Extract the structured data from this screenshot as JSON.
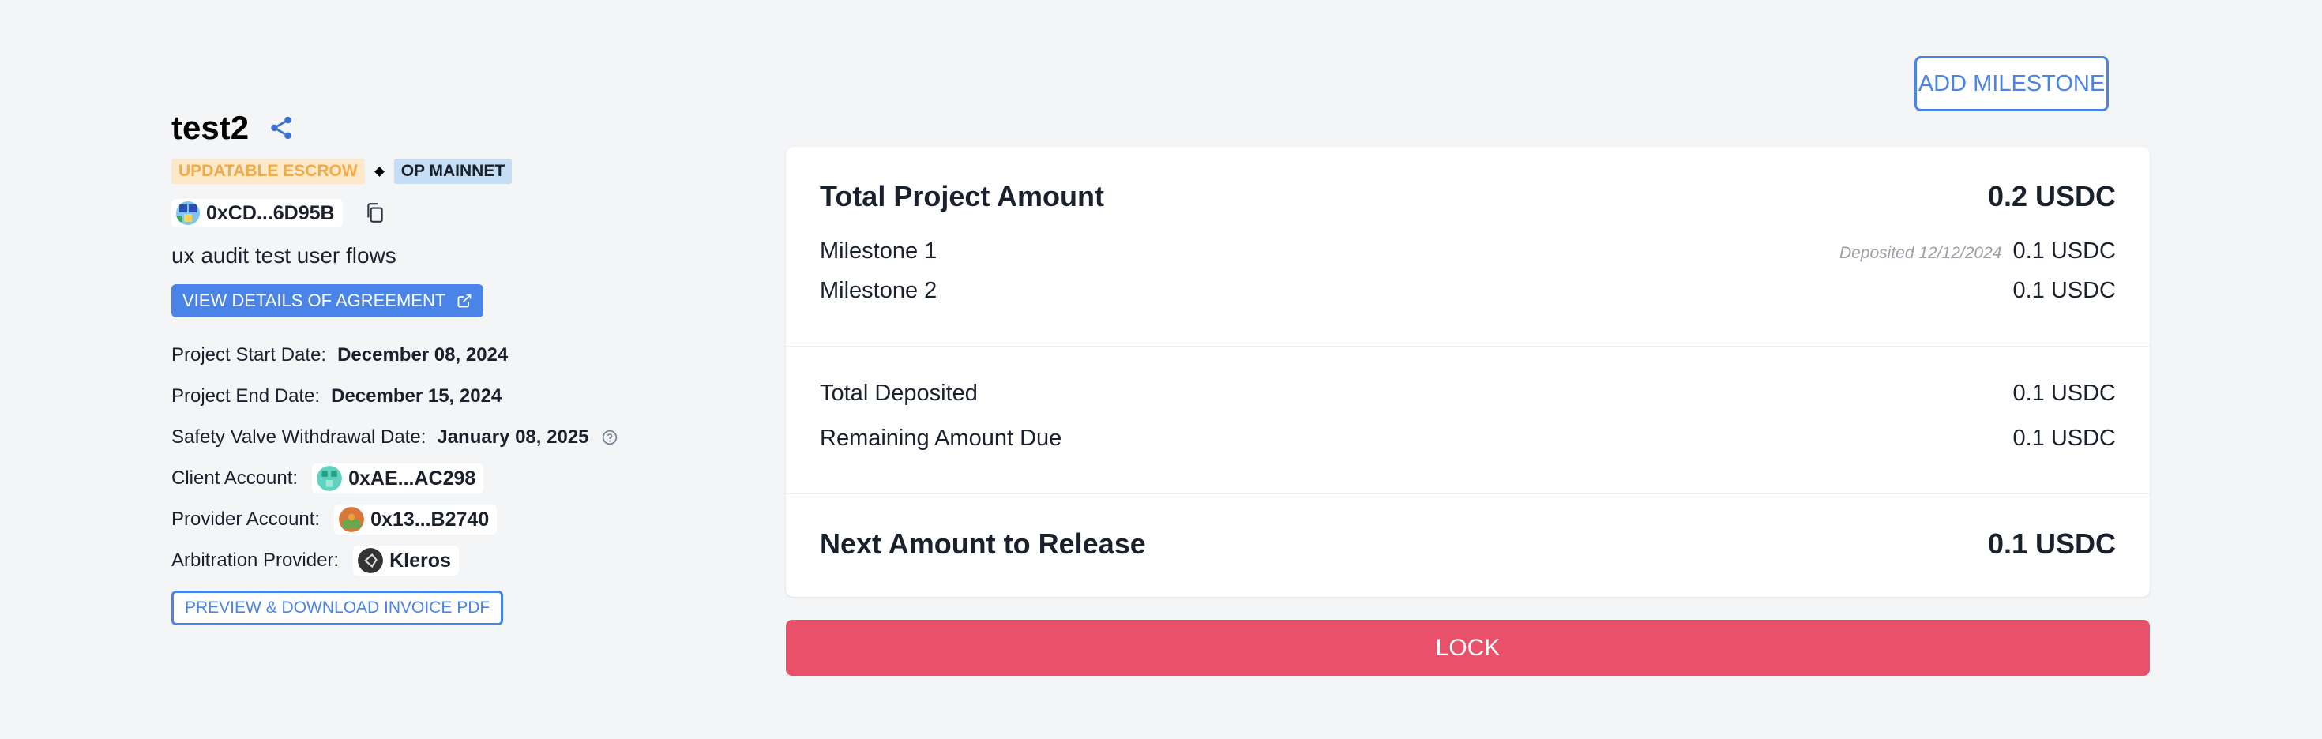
{
  "project": {
    "title": "test2",
    "escrow_badge": "UPDATABLE ESCROW",
    "network_badge": "OP MAINNET",
    "address": "0xCD...6D95B",
    "description": "ux audit test user flows",
    "view_details_label": "VIEW DETAILS OF AGREEMENT",
    "start_label": "Project Start Date:",
    "start_value": "December 08, 2024",
    "end_label": "Project End Date:",
    "end_value": "December 15, 2024",
    "safety_label": "Safety Valve Withdrawal Date:",
    "safety_value": "January 08, 2025",
    "client_label": "Client Account:",
    "client_value": "0xAE...AC298",
    "provider_label": "Provider Account:",
    "provider_value": "0x13...B2740",
    "arbitration_label": "Arbitration Provider:",
    "arbitration_value": "Kleros",
    "invoice_label": "PREVIEW & DOWNLOAD INVOICE PDF"
  },
  "actions": {
    "add_milestone": "ADD MILESTONE",
    "lock": "LOCK"
  },
  "summary": {
    "total_label": "Total Project Amount",
    "total_value": "0.2 USDC",
    "milestones": [
      {
        "label": "Milestone 1",
        "note": "Deposited 12/12/2024",
        "value": "0.1 USDC"
      },
      {
        "label": "Milestone 2",
        "note": "",
        "value": "0.1 USDC"
      }
    ],
    "deposited_label": "Total Deposited",
    "deposited_value": "0.1 USDC",
    "remaining_label": "Remaining Amount Due",
    "remaining_value": "0.1 USDC",
    "next_label": "Next Amount to Release",
    "next_value": "0.1 USDC"
  },
  "icons": {
    "share": "share-icon",
    "copy": "copy-icon",
    "external": "external-link-icon",
    "help": "help-circle-icon"
  },
  "colors": {
    "accent": "#4a84e8",
    "lock": "#e9506a",
    "escrow_badge_bg": "#fde8c8",
    "escrow_badge_text": "#f0ab4a",
    "network_badge_bg": "#c6def5"
  }
}
